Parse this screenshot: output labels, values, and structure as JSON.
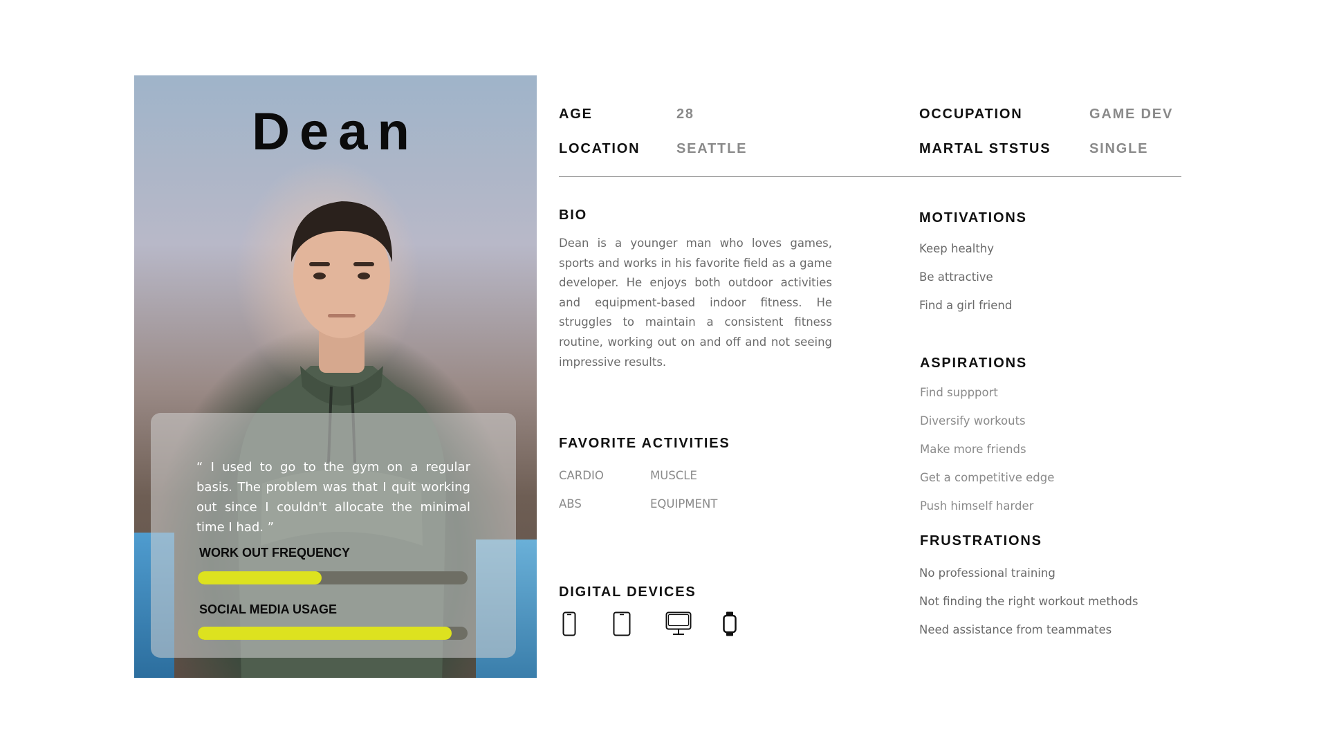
{
  "persona": {
    "name": "Dean",
    "quote": "“ I used to go to the gym on a regular basis. The problem was that I quit working out since I couldn't allocate the minimal time I had. ”",
    "meters": [
      {
        "label": "WORK OUT FREQUENCY",
        "value": 0.46
      },
      {
        "label": "SOCIAL MEDIA USAGE",
        "value": 0.94
      }
    ],
    "meter_track_color": "#6e6e64",
    "meter_fill_color": "#dde21f"
  },
  "details": {
    "age_label": "AGE",
    "age_value": "28",
    "location_label": "LOCATION",
    "location_value": "SEATTLE",
    "occupation_label": "OCCUPATION",
    "occupation_value": "GAME DEV",
    "marital_label": "MARTAL STSTUS",
    "marital_value": "SINGLE"
  },
  "bio": {
    "title": "BIO",
    "text": "Dean is a younger man who loves games, sports and works in his favorite field as a game developer. He enjoys both outdoor activities and equipment-based indoor fitness. He struggles to maintain a consistent fitness routine, working out on and off and not seeing impressive results."
  },
  "favorite_activities": {
    "title": "FAVORITE ACTIVITIES",
    "items": [
      "CARDIO",
      "MUSCLE",
      "ABS",
      "EQUIPMENT"
    ]
  },
  "digital_devices": {
    "title": "DIGITAL DEVICES",
    "icons": [
      "smartphone-icon",
      "tablet-icon",
      "desktop-monitor-icon",
      "smartwatch-icon"
    ]
  },
  "motivations": {
    "title": "MOTIVATIONS",
    "items": [
      "Keep healthy",
      "Be attractive",
      "Find a girl friend"
    ]
  },
  "aspirations": {
    "title": "ASPIRATIONS",
    "items": [
      "Find suppport",
      "Diversify workouts",
      "Make more friends",
      "Get a competitive edge",
      "Push himself harder"
    ]
  },
  "frustrations": {
    "title": "FRUSTRATIONS",
    "items": [
      "No professional training",
      "Not finding the right workout methods",
      "Need assistance from teammates"
    ]
  }
}
